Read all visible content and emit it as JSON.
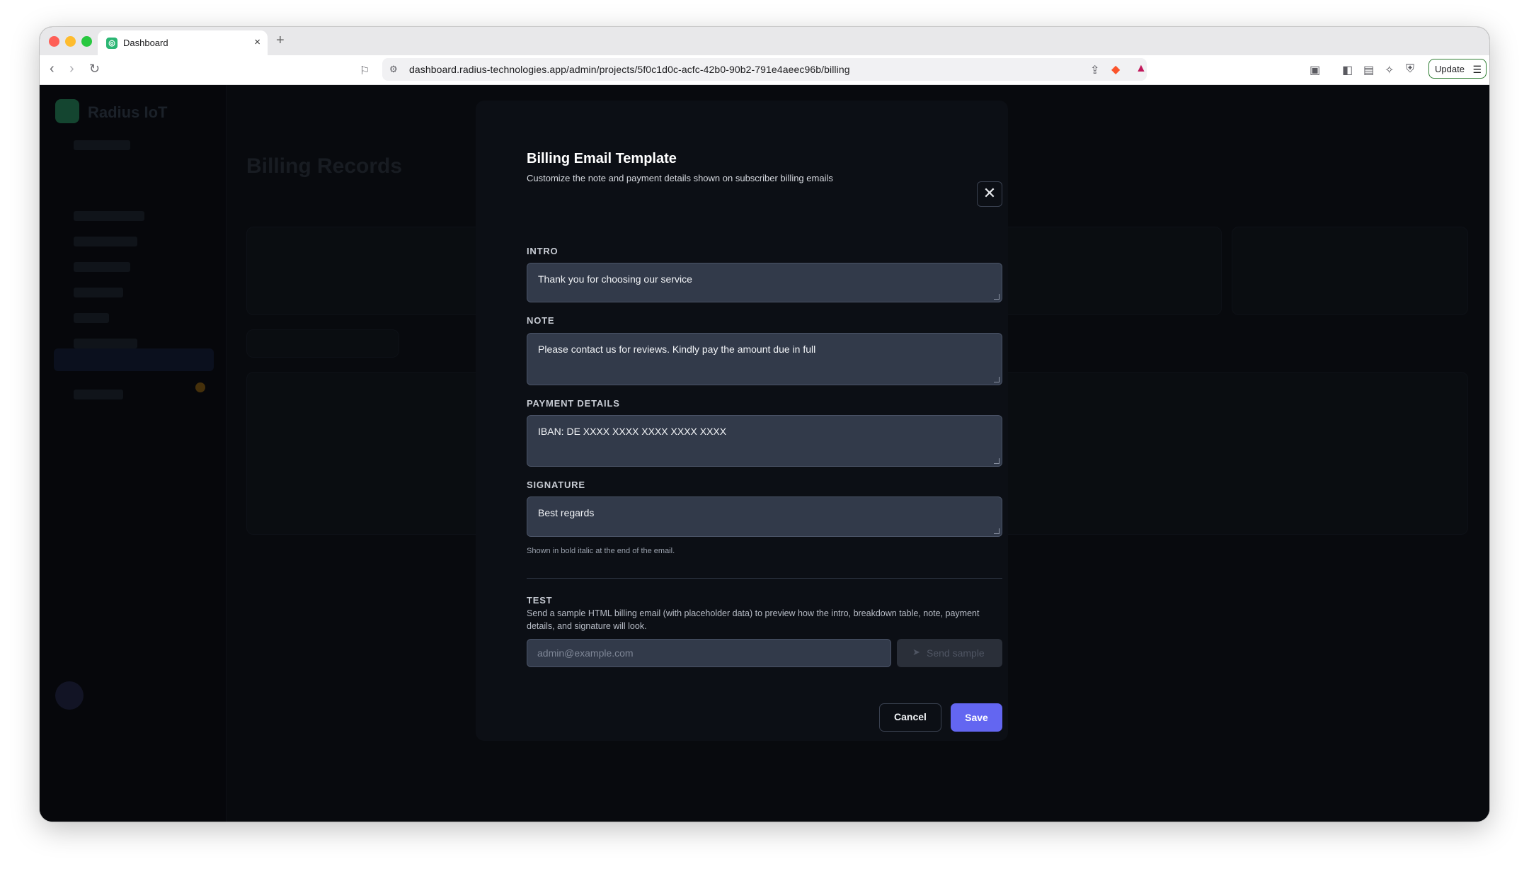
{
  "browser": {
    "tab_title": "Dashboard",
    "new_tab": "+",
    "url_host": "dashboard.radius-technologies.app",
    "url_path": "/admin/projects/5f0c1d0c-acfc-42b0-90b2-791e4aeec96b/billing",
    "update_label": "Update"
  },
  "background": {
    "brand": "Radius IoT",
    "page_title": "Billing Records"
  },
  "modal": {
    "title": "Billing Email Template",
    "subtitle": "Customize the note and payment details shown on subscriber billing emails",
    "close_symbol": "✕",
    "intro_label": "INTRO",
    "intro_value": "Thank you for choosing our service",
    "note_label": "NOTE",
    "note_value": "Please contact us for reviews. Kindly pay the amount due in full",
    "payment_label": "PAYMENT DETAILS",
    "payment_value": "IBAN: DE XXXX XXXX XXXX XXXX XXXX",
    "signature_label": "SIGNATURE",
    "signature_value": "Best regards",
    "signature_hint": "Shown in bold italic at the end of the email.",
    "test_label": "TEST",
    "test_description": "Send a sample HTML billing email (with placeholder data) to preview how the intro, breakdown table, note, payment details, and signature will look.",
    "test_email_placeholder": "admin@example.com",
    "send_sample_label": "Send sample",
    "cancel_label": "Cancel",
    "save_label": "Save"
  },
  "colors": {
    "accent": "#6366f1",
    "field_bg": "#323a4a",
    "modal_bg": "#0c0f15"
  }
}
